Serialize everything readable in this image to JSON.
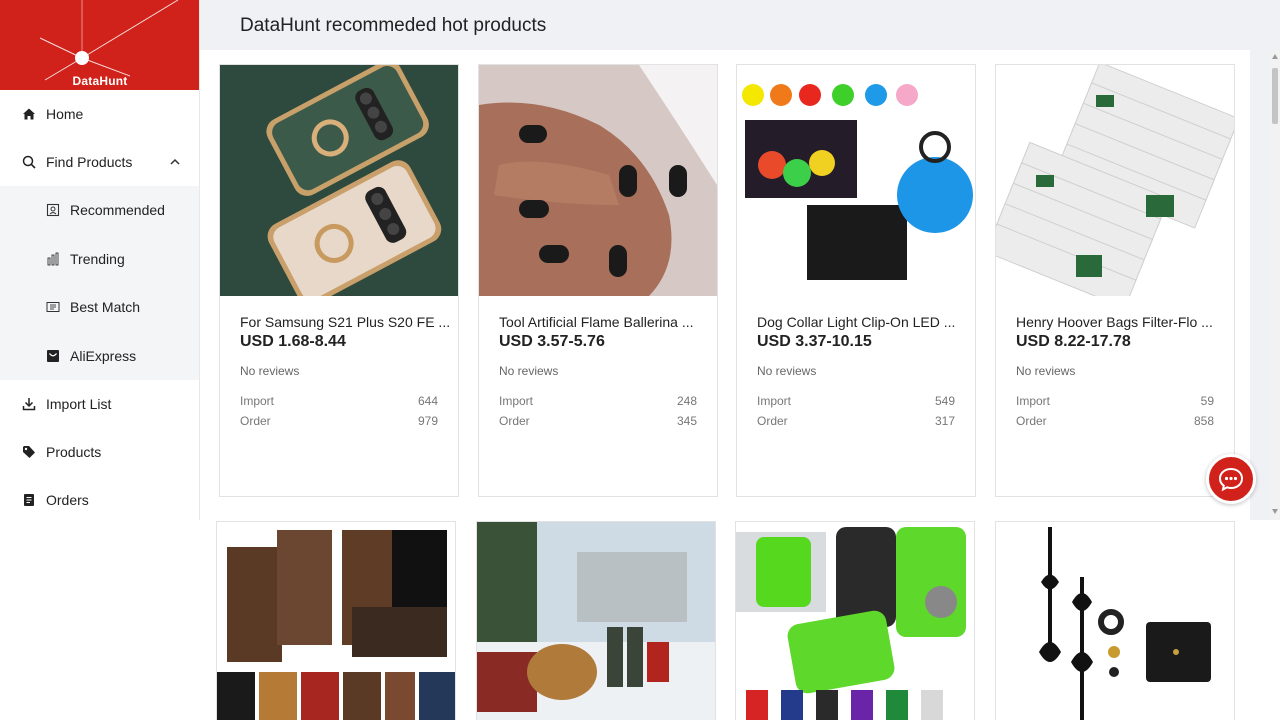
{
  "brand": {
    "logo_text": "DataHunt",
    "accent": "#d0211a"
  },
  "header": {
    "title": "DataHunt recommeded hot products"
  },
  "sidebar": {
    "items": [
      {
        "label": "Home",
        "icon": "home-icon"
      },
      {
        "label": "Find Products",
        "icon": "search-icon",
        "expanded": true
      },
      {
        "label": "Recommended",
        "icon": "recommended-icon"
      },
      {
        "label": "Trending",
        "icon": "trending-icon"
      },
      {
        "label": "Best Match",
        "icon": "best-match-icon"
      },
      {
        "label": "AliExpress",
        "icon": "aliexpress-icon"
      },
      {
        "label": "Import List",
        "icon": "import-icon"
      },
      {
        "label": "Products",
        "icon": "tag-icon"
      },
      {
        "label": "Orders",
        "icon": "orders-icon"
      }
    ]
  },
  "products": [
    {
      "title": "For Samsung S21 Plus S20 FE ...",
      "price": "USD 1.68-8.44",
      "reviews": "No reviews",
      "import_label": "Import",
      "import": "644",
      "order_label": "Order",
      "order": "979"
    },
    {
      "title": "Tool Artificial Flame Ballerina ...",
      "price": "USD 3.57-5.76",
      "reviews": "No reviews",
      "import_label": "Import",
      "import": "248",
      "order_label": "Order",
      "order": "345"
    },
    {
      "title": "Dog Collar Light Clip-On LED ...",
      "price": "USD 3.37-10.15",
      "reviews": "No reviews",
      "import_label": "Import",
      "import": "549",
      "order_label": "Order",
      "order": "317"
    },
    {
      "title": "Henry Hoover Bags Filter-Flo ...",
      "price": "USD 8.22-17.78",
      "reviews": "No reviews",
      "import_label": "Import",
      "import": "59",
      "order_label": "Order",
      "order": "858"
    }
  ]
}
